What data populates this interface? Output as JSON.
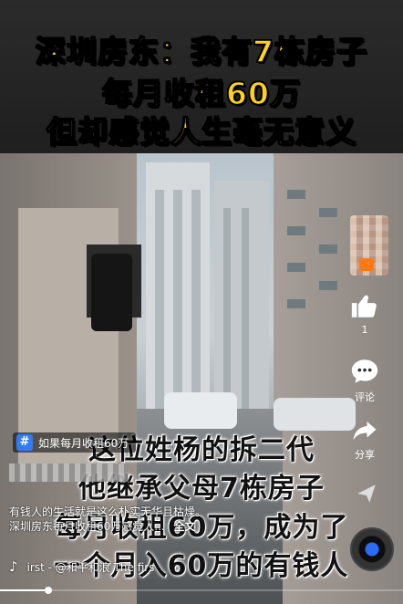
{
  "title_lines": [
    "深圳房东：我有7栋房子",
    "每月收租60万",
    "但却感觉人生毫无意义"
  ],
  "video_subtitles": [
    "这位姓杨的拆二代",
    "他继承父母7栋房子",
    "每月收租60万，成为了",
    "一个月入60万的有钱人"
  ],
  "hashtag": {
    "badge": "#",
    "text": "如果每月收租60万"
  },
  "caption": {
    "line1": "有钱人的生活就是这么朴实无华且枯燥。",
    "line2": "深圳房东每月收租60万感觉人...",
    "expand": "全文"
  },
  "music": {
    "text": "irst - @和平和浪    The firs"
  },
  "rail": {
    "like_count": "1",
    "comment_label": "评论",
    "share_label": "分享"
  },
  "progress": {
    "fraction": 0.12
  },
  "colors": {
    "title_yellow": "#ffd21a",
    "hashtag_blue": "#2f7cf6",
    "avatar_accent": "#ff7a12"
  },
  "icons": [
    "like-icon",
    "comment-icon",
    "share-icon",
    "collect-icon",
    "music-note-icon",
    "hashtag-icon"
  ]
}
